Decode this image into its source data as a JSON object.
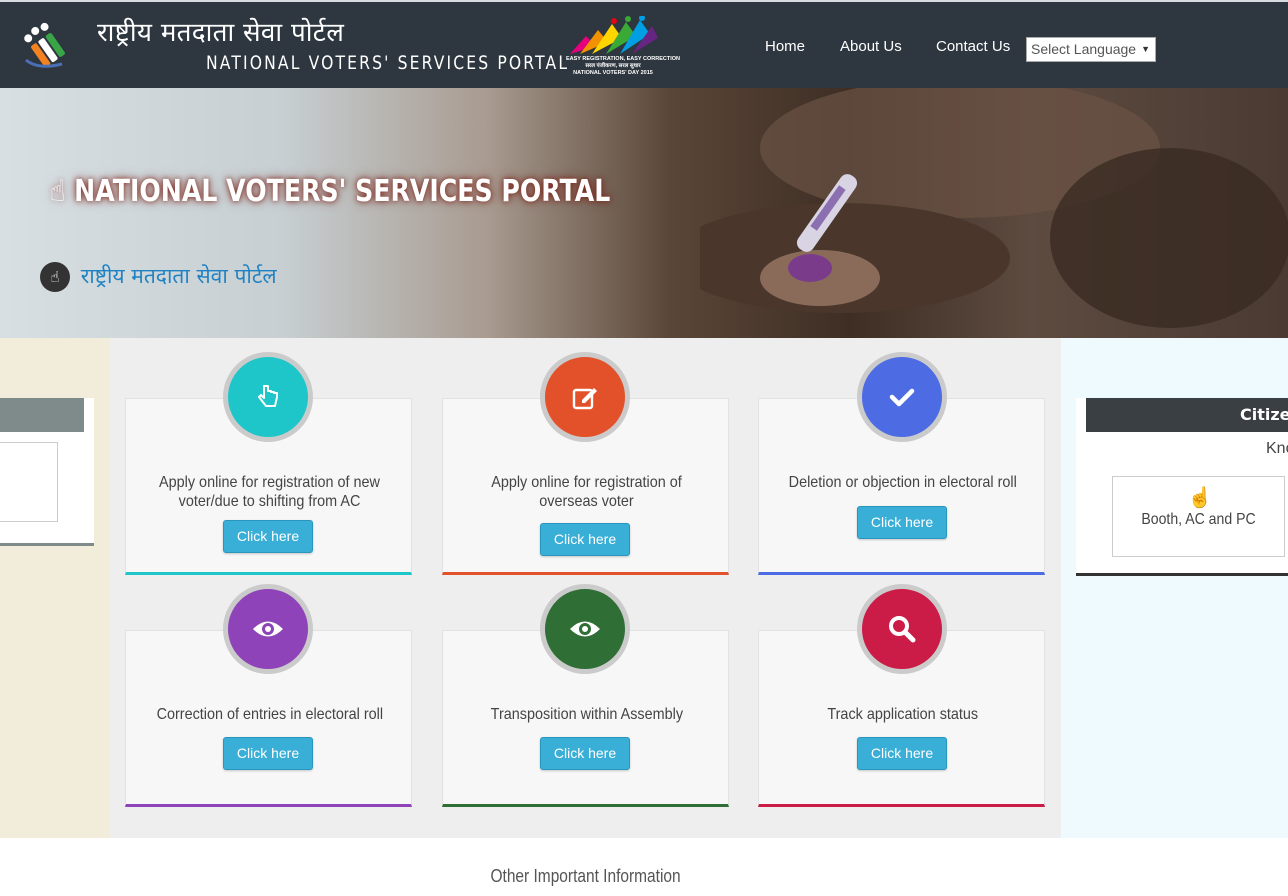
{
  "header": {
    "title_hindi": "राष्ट्रीय मतदाता सेवा पोर्टल",
    "title_english": "NATIONAL VOTERS' SERVICES PORTAL",
    "badge_lines": [
      "EASY REGISTRATION, EASY CORRECTION",
      "सरल पंजीकरण, सरल सुधार",
      "NATIONAL VOTERS' DAY 2015"
    ],
    "nav": [
      "Home",
      "About Us",
      "Contact Us"
    ],
    "language_select": "Select Language"
  },
  "banner": {
    "heading_english": "NATIONAL VOTERS' SERVICES PORTAL",
    "heading_hindi": "राष्ट्रीय मतदाता सेवा पोर्टल"
  },
  "services": [
    {
      "label": "Apply online for registration of new voter/due to shifting from AC",
      "button": "Click here",
      "icon": "hand-pointer-icon",
      "color": "#1fc6c9"
    },
    {
      "label": "Apply online for registration of overseas voter",
      "button": "Click here",
      "icon": "edit-icon",
      "color": "#e2512a"
    },
    {
      "label": "Deletion or objection in electoral roll",
      "button": "Click here",
      "icon": "check-icon",
      "color": "#4d6be3"
    },
    {
      "label": "Correction of entries in electoral roll",
      "button": "Click here",
      "icon": "eye-icon",
      "color": "#8e44b8"
    },
    {
      "label": "Transposition within Assembly",
      "button": "Click here",
      "icon": "eye-icon",
      "color": "#2f6e34"
    },
    {
      "label": "Track application status",
      "button": "Click here",
      "icon": "search-icon",
      "color": "#cb1c47"
    }
  ],
  "right_panel": {
    "title": "Citizen",
    "subtitle": "Kno",
    "link": "Booth, AC and PC"
  },
  "footer": {
    "heading": "Other Important Information"
  }
}
